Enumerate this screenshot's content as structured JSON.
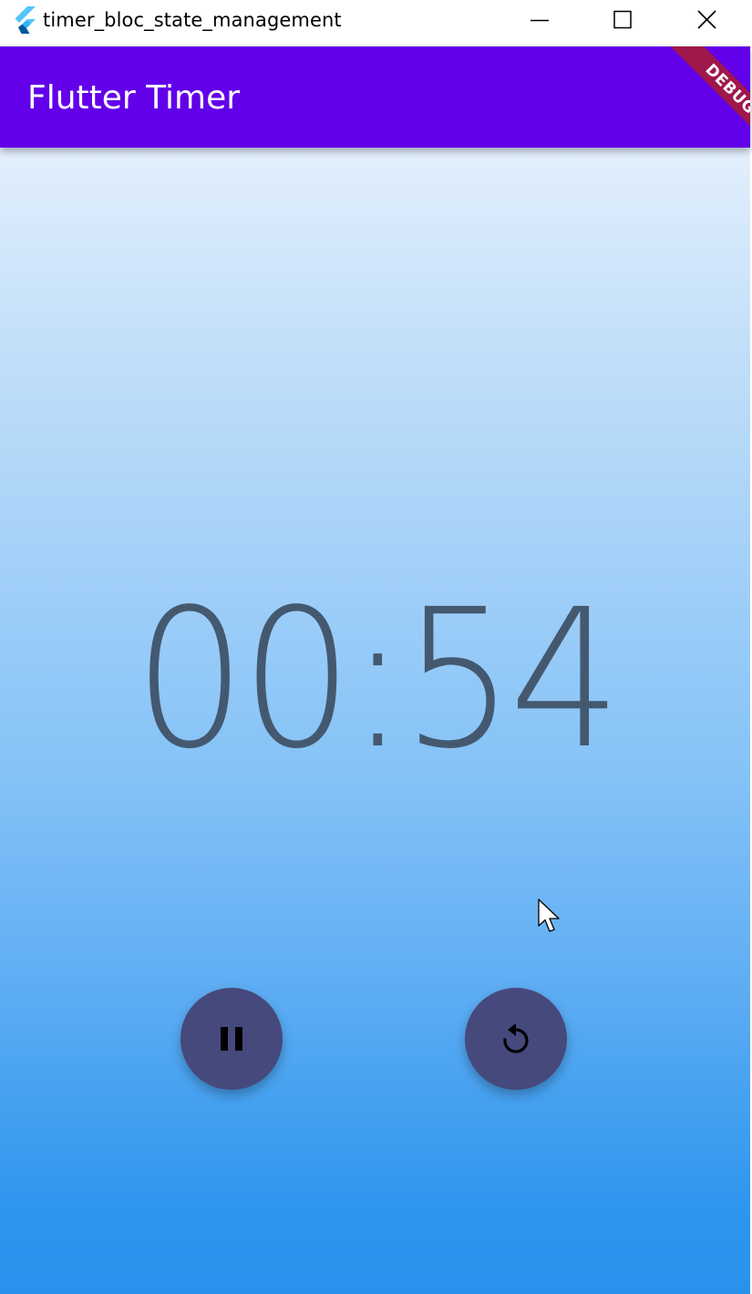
{
  "window": {
    "title": "timer_bloc_state_management",
    "icon": "flutter-logo-icon",
    "controls": [
      "minimize-icon",
      "maximize-icon",
      "close-icon"
    ]
  },
  "appbar": {
    "title": "Flutter Timer",
    "color": "#6200ea"
  },
  "debug_banner": {
    "label": "DEBUG",
    "color": "#a0174b"
  },
  "timer": {
    "display": "00:54",
    "color": "#44596f"
  },
  "actions": {
    "pause": {
      "icon": "pause-icon",
      "color": "#46497b"
    },
    "reset": {
      "icon": "replay-icon",
      "color": "#46497b"
    }
  },
  "background_gradient": [
    "#e3effc",
    "#2a92ed"
  ]
}
